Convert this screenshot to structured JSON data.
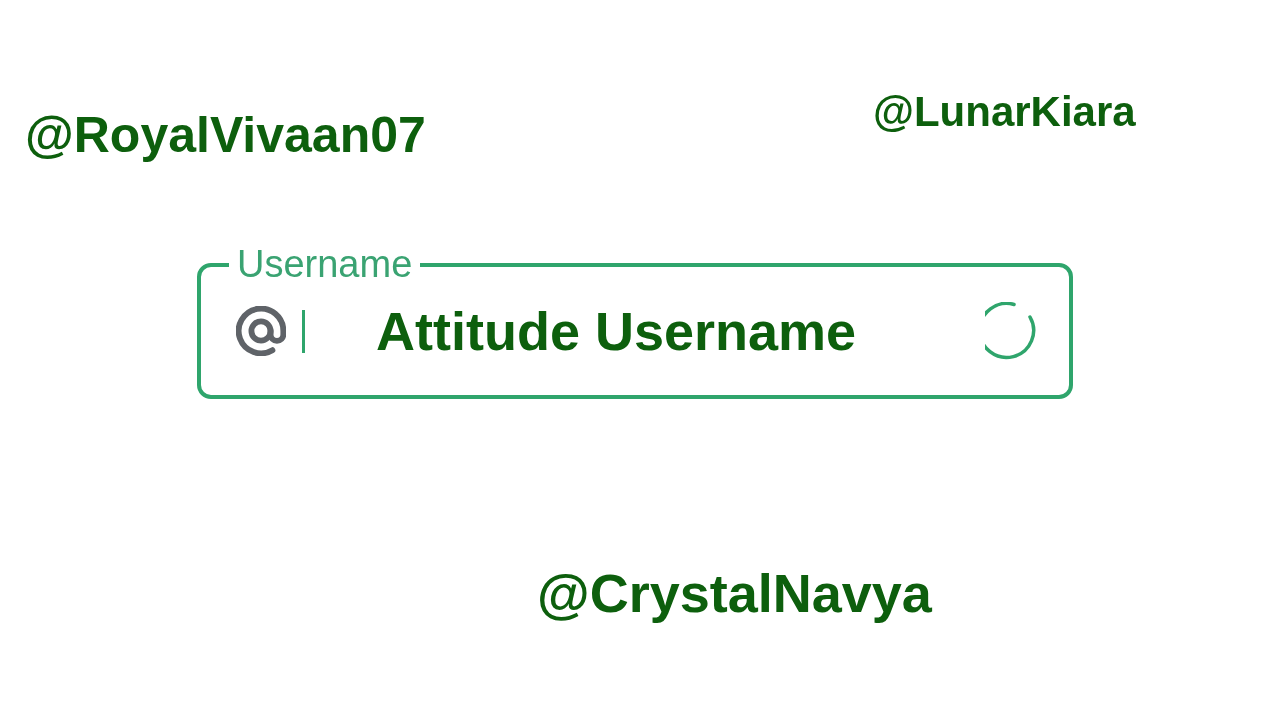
{
  "floating_usernames": [
    {
      "text": "@RoyalVivaan07"
    },
    {
      "text": "@LunarKiara"
    },
    {
      "text": "@CrystalNavya"
    }
  ],
  "field": {
    "label": "Username",
    "value": "Attitude Username",
    "loading": true
  }
}
